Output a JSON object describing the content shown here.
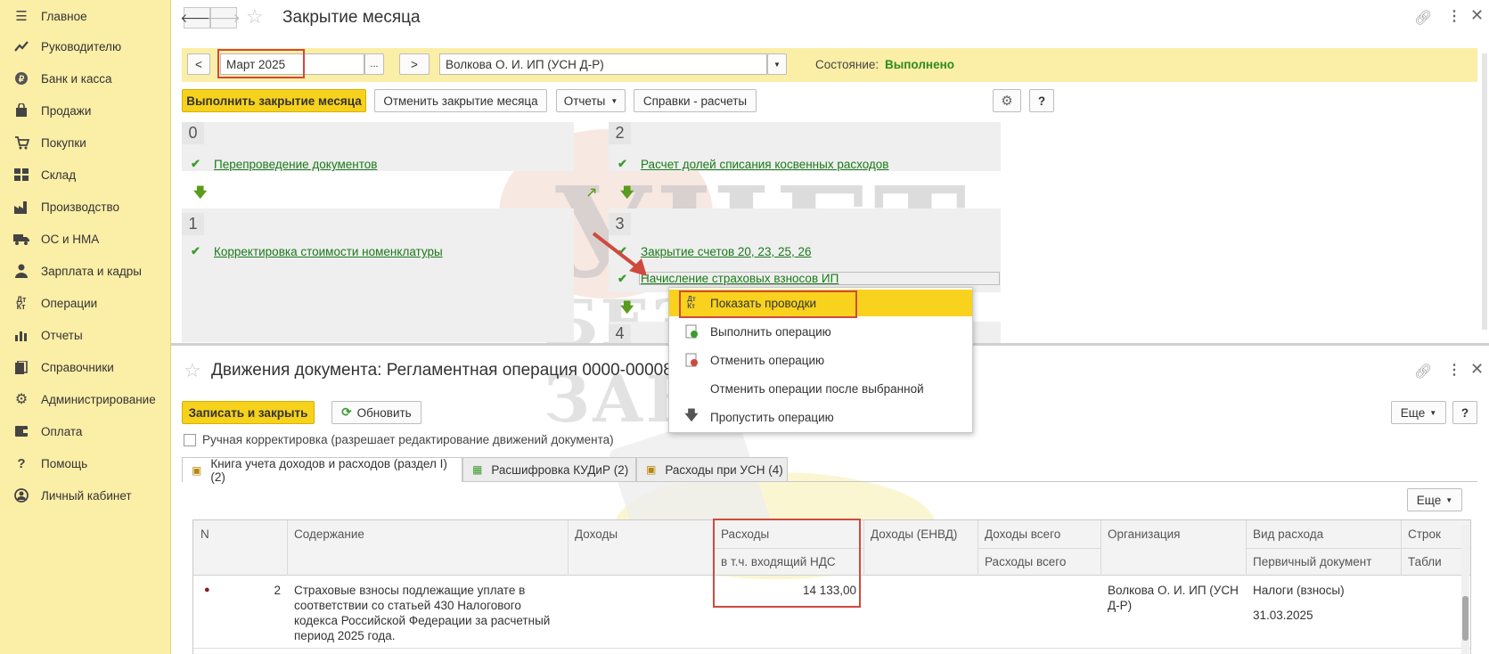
{
  "sidebar": {
    "items": [
      {
        "label": "Главное",
        "icon": "menu-icon"
      },
      {
        "label": "Руководителю",
        "icon": "trend-icon"
      },
      {
        "label": "Банк и касса",
        "icon": "ruble-icon"
      },
      {
        "label": "Продажи",
        "icon": "bag-icon"
      },
      {
        "label": "Покупки",
        "icon": "cart-icon"
      },
      {
        "label": "Склад",
        "icon": "grid-icon"
      },
      {
        "label": "Производство",
        "icon": "factory-icon"
      },
      {
        "label": "ОС и НМА",
        "icon": "truck-icon"
      },
      {
        "label": "Зарплата и кадры",
        "icon": "person-icon"
      },
      {
        "label": "Операции",
        "icon": "dt-kt-icon"
      },
      {
        "label": "Отчеты",
        "icon": "bar-chart-icon"
      },
      {
        "label": "Справочники",
        "icon": "books-icon"
      },
      {
        "label": "Администрирование",
        "icon": "gear-icon"
      },
      {
        "label": "Оплата",
        "icon": "wallet-icon"
      },
      {
        "label": "Помощь",
        "icon": "question-icon"
      },
      {
        "label": "Личный кабинет",
        "icon": "user-circle-icon"
      }
    ]
  },
  "top": {
    "title": "Закрытие месяца",
    "period_prev": "<",
    "period_value": "Март 2025",
    "period_dots": "...",
    "period_next": ">",
    "organization": "Волкова О. И. ИП (УСН Д-Р)",
    "state_label": "Состояние:",
    "state_value": "Выполнено",
    "btn_run": "Выполнить закрытие месяца",
    "btn_cancel": "Отменить закрытие месяца",
    "btn_reports": "Отчеты",
    "btn_refs": "Справки - расчеты",
    "btn_help": "?",
    "steps": [
      {
        "num": "0",
        "ops": [
          "Перепроведение документов"
        ]
      },
      {
        "num": "1",
        "ops": [
          "Корректировка стоимости номенклатуры"
        ]
      },
      {
        "num": "2",
        "ops": [
          "Расчет долей списания косвенных расходов"
        ]
      },
      {
        "num": "3",
        "ops": [
          "Закрытие счетов 20, 23, 25, 26",
          "Начисление страховых взносов ИП"
        ]
      },
      {
        "num": "4",
        "ops": []
      }
    ]
  },
  "context_menu": {
    "items": [
      {
        "label": "Показать проводки",
        "icon": "dt-kt-icon"
      },
      {
        "label": "Выполнить операцию",
        "icon": "run-doc-icon"
      },
      {
        "label": "Отменить операцию",
        "icon": "cancel-doc-icon"
      },
      {
        "label": "Отменить операции после выбранной",
        "icon": ""
      },
      {
        "label": "Пропустить операцию",
        "icon": "skip-down-icon"
      }
    ]
  },
  "bottom": {
    "title": "Движения документа: Регламентная операция 0000-00008",
    "btn_save": "Записать и закрыть",
    "btn_refresh": "Обновить",
    "btn_more": "Еще",
    "btn_help": "?",
    "manual_label": "Ручная корректировка (разрешает редактирование движений документа)",
    "tabs": [
      {
        "label": "Книга учета доходов и расходов (раздел I) (2)"
      },
      {
        "label": "Расшифровка КУДиР (2)"
      },
      {
        "label": "Расходы при УСН (4)"
      }
    ],
    "table_more": "Еще",
    "columns": {
      "n": "N",
      "content": "Содержание",
      "income": "Доходы",
      "expenses": "Расходы",
      "expenses_vat": "в т.ч. входящий НДС",
      "income_envd": "Доходы (ЕНВД)",
      "income_total": "Доходы всего",
      "expenses_total": "Расходы всего",
      "org": "Организация",
      "expense_type": "Вид расхода",
      "primary_doc": "Первичный документ",
      "line": "Строк",
      "table": "Табли"
    },
    "rows": [
      {
        "n": "2",
        "content": "Страховые взносы подлежащие уплате в соответствии со статьей 430 Налогового кодекса Российской Федерации за расчетный период 2025 года.",
        "expenses": "14 133,00",
        "org": "Волкова О. И. ИП (УСН Д-Р)",
        "expense_type": "Налоги (взносы)",
        "primary_doc": "31.03.2025"
      }
    ]
  },
  "watermark": {
    "line1": "УЧЕТ",
    "line2": "БЕЗ ЗАБОТ"
  },
  "colors": {
    "sidebar_bg": "#fbeea6",
    "accent_yellow": "#f7d21c",
    "link_green": "#1a7a1a",
    "state_green": "#2e8b1e",
    "highlight_red": "#cf4a3e"
  }
}
